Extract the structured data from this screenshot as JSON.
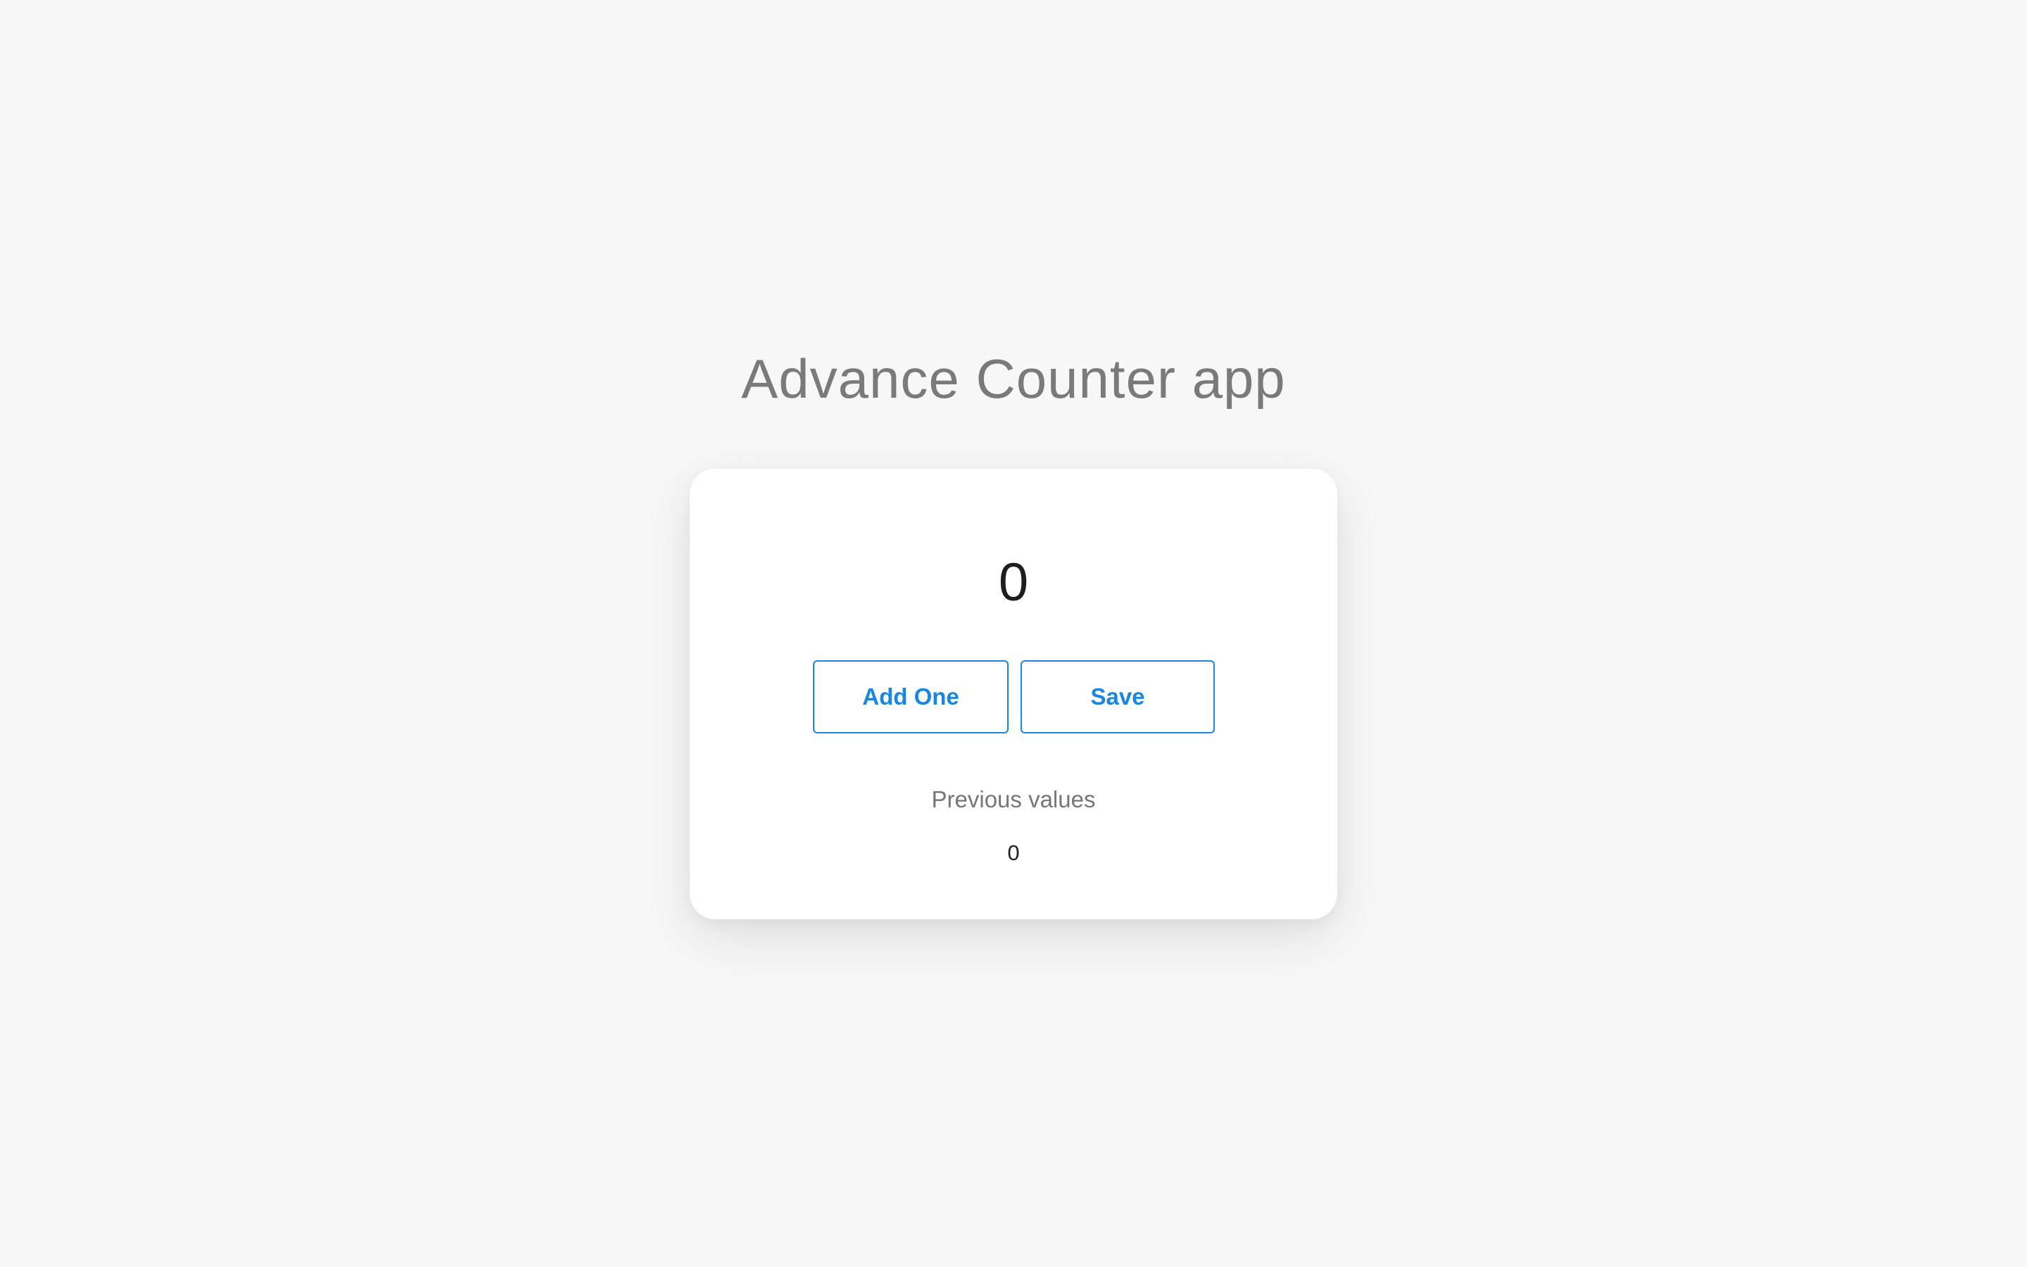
{
  "app": {
    "title": "Advance Counter app"
  },
  "counter": {
    "value": "0"
  },
  "actions": {
    "add_one_label": "Add One",
    "save_label": "Save"
  },
  "history": {
    "heading": "Previous values",
    "values": [
      "0"
    ]
  },
  "colors": {
    "background": "#f7f7f7",
    "card": "#ffffff",
    "accent": "#1a86e0",
    "title_text": "#7a7a7a",
    "muted_text": "#767676",
    "value_text": "#1e1e1e"
  }
}
